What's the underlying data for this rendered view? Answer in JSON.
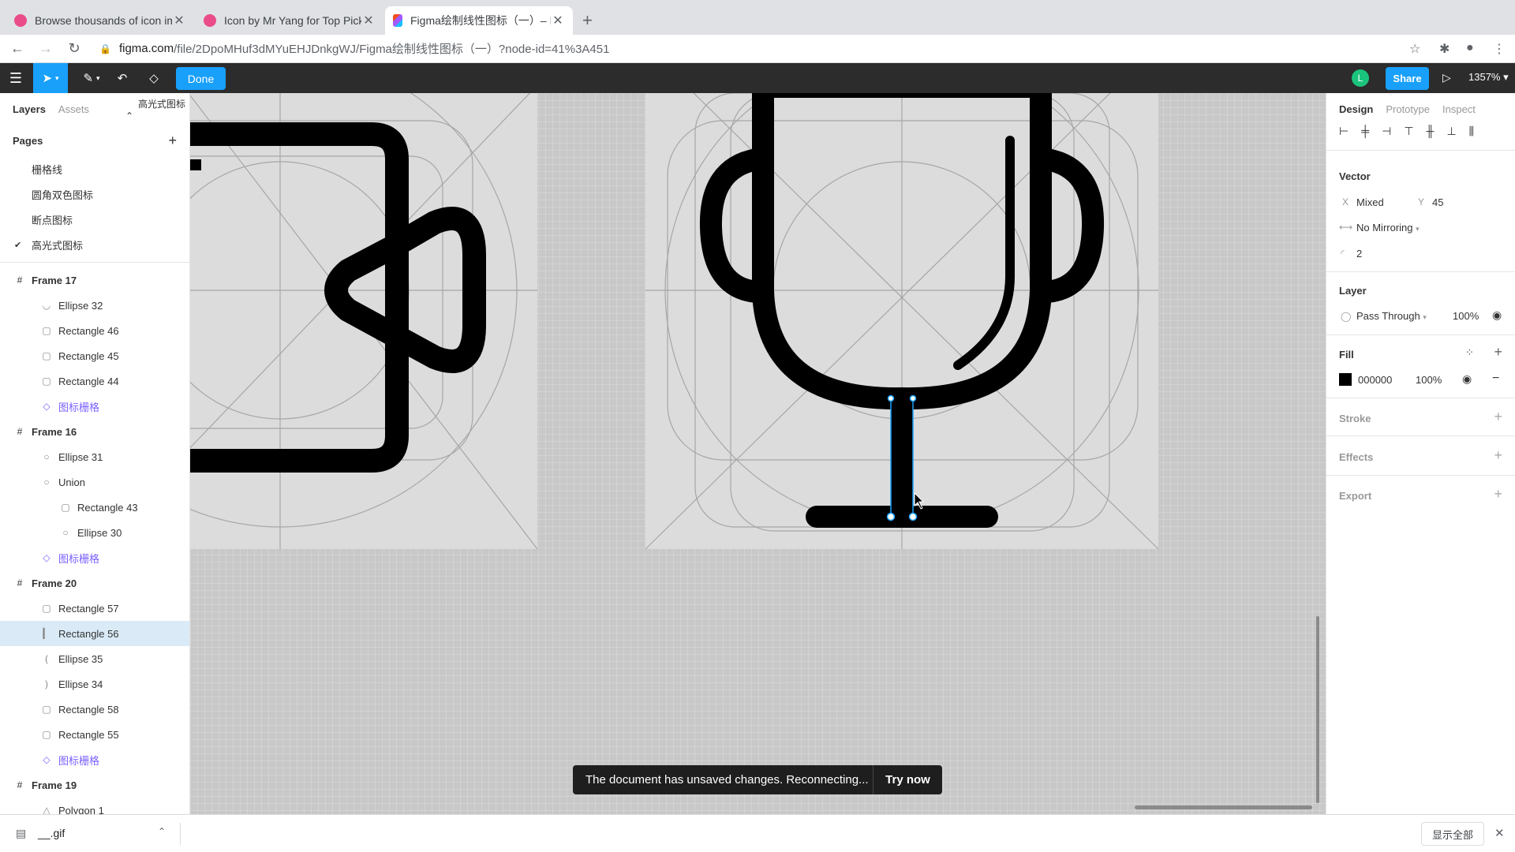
{
  "browser": {
    "tabs": [
      {
        "title": "Browse thousands of icon imag",
        "color": "#ea4c89"
      },
      {
        "title": "Icon by Mr Yang for Top Pick S",
        "color": "#ea4c89"
      },
      {
        "title": "Figma绘制线性图标（一）– Fig",
        "color": "#f24e1e"
      }
    ],
    "url_host": "figma.com",
    "url_path": "/file/2DpoMHuf3dMYuEHJDnkgWJ/Figma绘制线性图标（一）?node-id=41%3A451"
  },
  "toolbar": {
    "done_label": "Done",
    "avatar_initial": "L",
    "share_label": "Share",
    "zoom": "1357%"
  },
  "left_panel": {
    "tab_layers": "Layers",
    "tab_assets": "Assets",
    "current_page": "高光式图标",
    "pages_title": "Pages",
    "pages": [
      "栅格线",
      "圆角双色图标",
      "断点图标",
      "高光式图标"
    ],
    "layers": [
      {
        "name": "Frame 17",
        "type": "frame",
        "indent": 0
      },
      {
        "name": "Ellipse 32",
        "type": "arc",
        "indent": 1
      },
      {
        "name": "Rectangle 46",
        "type": "rect",
        "indent": 1
      },
      {
        "name": "Rectangle 45",
        "type": "rect",
        "indent": 1
      },
      {
        "name": "Rectangle 44",
        "type": "rect",
        "indent": 1
      },
      {
        "name": "图标栅格",
        "type": "comp",
        "indent": 1
      },
      {
        "name": "Frame 16",
        "type": "frame",
        "indent": 0
      },
      {
        "name": "Ellipse 31",
        "type": "ellipse",
        "indent": 1
      },
      {
        "name": "Union",
        "type": "ellipse",
        "indent": 1
      },
      {
        "name": "Rectangle 43",
        "type": "rect",
        "indent": 2
      },
      {
        "name": "Ellipse 30",
        "type": "ellipse",
        "indent": 2
      },
      {
        "name": "图标栅格",
        "type": "comp",
        "indent": 1
      },
      {
        "name": "Frame 20",
        "type": "frame",
        "indent": 0
      },
      {
        "name": "Rectangle 57",
        "type": "rect",
        "indent": 1
      },
      {
        "name": "Rectangle 56",
        "type": "bar",
        "indent": 1,
        "selected": true
      },
      {
        "name": "Ellipse 35",
        "type": "arc-l",
        "indent": 1
      },
      {
        "name": "Ellipse 34",
        "type": "arc-r",
        "indent": 1
      },
      {
        "name": "Rectangle 58",
        "type": "rect",
        "indent": 1
      },
      {
        "name": "Rectangle 55",
        "type": "rect",
        "indent": 1
      },
      {
        "name": "图标栅格",
        "type": "comp",
        "indent": 1
      },
      {
        "name": "Frame 19",
        "type": "frame",
        "indent": 0
      },
      {
        "name": "Polygon 1",
        "type": "poly",
        "indent": 1
      }
    ]
  },
  "canvas": {
    "toast_message": "The document has unsaved changes. Reconnecting...",
    "toast_action": "Try now",
    "help_label": "?"
  },
  "right_panel": {
    "tab_design": "Design",
    "tab_prototype": "Prototype",
    "tab_inspect": "Inspect",
    "vector_title": "Vector",
    "x_label": "X",
    "x_value": "Mixed",
    "y_label": "Y",
    "y_value": "45",
    "mirroring": "No Mirroring",
    "corner_radius": "2",
    "layer_title": "Layer",
    "blend_mode": "Pass Through",
    "layer_opacity": "100%",
    "fill_title": "Fill",
    "fill_hex": "000000",
    "fill_opacity": "100%",
    "fill_color": "#000000",
    "stroke_title": "Stroke",
    "effects_title": "Effects",
    "export_title": "Export"
  },
  "download_bar": {
    "file_name": "__.gif",
    "show_all": "显示全部"
  }
}
